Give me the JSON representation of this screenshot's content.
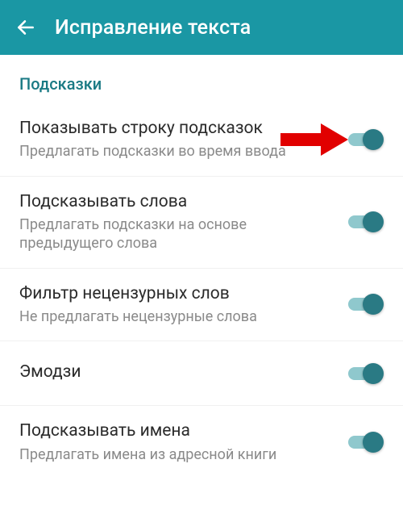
{
  "appbar": {
    "title": "Исправление текста"
  },
  "section": {
    "header": "Подсказки"
  },
  "settings": [
    {
      "title": "Показывать строку подсказок",
      "subtitle": "Предлагать подсказки во время ввода",
      "on": true
    },
    {
      "title": "Подсказывать слова",
      "subtitle": "Предлагать подсказки на основе предыдущего слова",
      "on": true
    },
    {
      "title": "Фильтр нецензурных слов",
      "subtitle": "Не предлагать нецензурные слова",
      "on": true
    },
    {
      "title": "Эмодзи",
      "subtitle": "",
      "on": true
    },
    {
      "title": "Подсказывать имена",
      "subtitle": "Предлагать имена из адресной книги",
      "on": true
    }
  ],
  "annotation": {
    "arrow_color": "#e10000"
  }
}
